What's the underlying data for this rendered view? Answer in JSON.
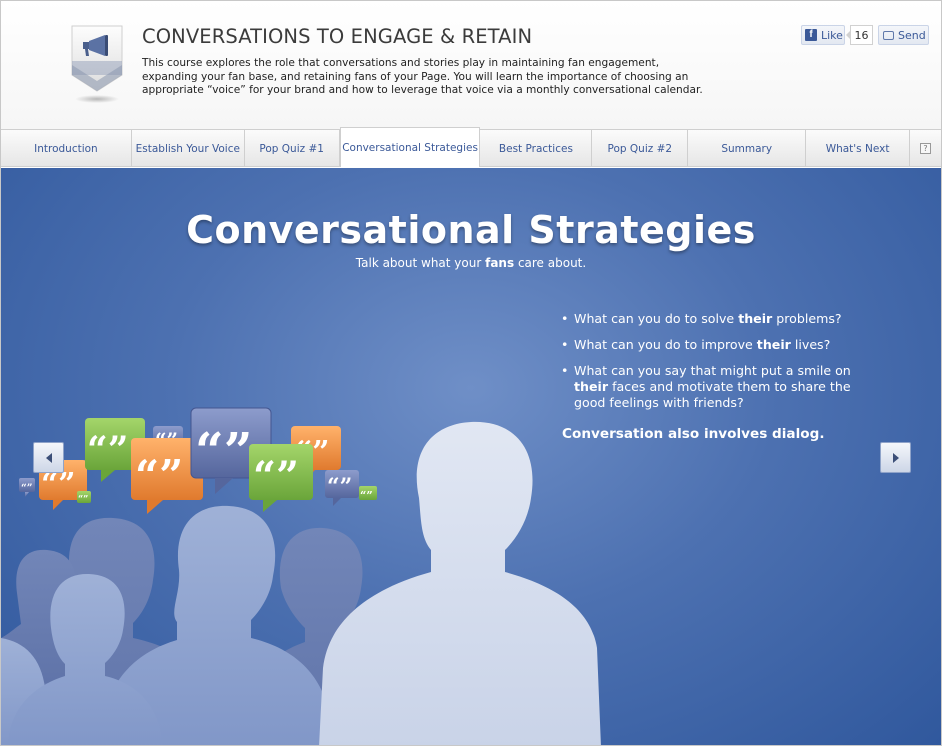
{
  "header": {
    "title": "CONVERSATIONS TO ENGAGE & RETAIN",
    "description": "This course explores the role that conversations and stories play in maintaining fan engagement, expanding your fan base, and retaining fans of your Page. You will learn the importance of choosing an appropriate “voice” for your brand and how to leverage that voice via a monthly conversational calendar.",
    "icon": "megaphone-icon"
  },
  "social": {
    "like_label": "Like",
    "like_count": "16",
    "send_label": "Send"
  },
  "tabs": [
    {
      "label": "Introduction"
    },
    {
      "label": "Establish Your Voice"
    },
    {
      "label": "Pop Quiz #1"
    },
    {
      "label": "Conversational Strategies"
    },
    {
      "label": "Best Practices"
    },
    {
      "label": "Pop Quiz #2"
    },
    {
      "label": "Summary"
    },
    {
      "label": "What's Next"
    }
  ],
  "active_tab": "Conversational Strategies",
  "help_icon": "?",
  "stage": {
    "title": "Conversational Strategies",
    "subtitle_pre": "Talk about what your ",
    "subtitle_bold": "fans",
    "subtitle_post": " care about.",
    "bullets": [
      {
        "pre": "What can you do to solve ",
        "bold": "their",
        "post": " problems?"
      },
      {
        "pre": "What can you do to improve ",
        "bold": "their",
        "post": " lives?"
      },
      {
        "pre": "What can you say that might put a smile on ",
        "bold": "their",
        "post": " faces and motivate them to share the good feelings with friends?"
      }
    ],
    "dialog_note": "Conversation also involves dialog.",
    "bubble_glyph": "“”"
  },
  "colors": {
    "stage_blue": "#4d71b1",
    "tab_text": "#3b5998",
    "bubble_green": "#8cc152",
    "bubble_orange": "#f0974b",
    "bubble_blue": "#6d7fb5"
  }
}
